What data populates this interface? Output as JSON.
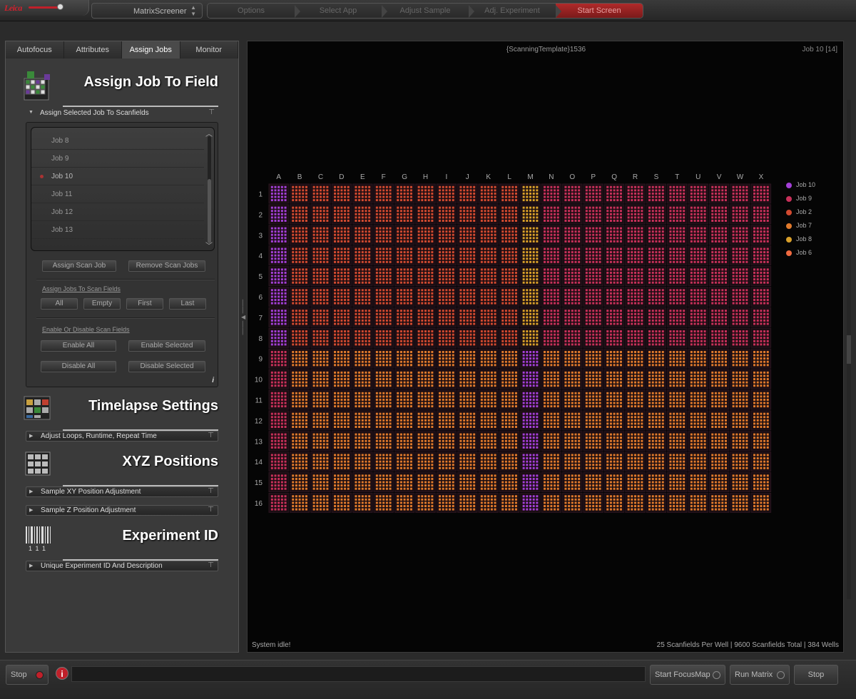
{
  "app": {
    "logo_text": "Leica",
    "selector_label": "MatrixScreener"
  },
  "workflow": {
    "steps": [
      "Options",
      "Select App",
      "Adjust Sample",
      "Adj. Experiment",
      "Start Screen"
    ]
  },
  "tabs": [
    "Autofocus",
    "Attributes",
    "Assign Jobs",
    "Monitor"
  ],
  "assign": {
    "title": "Assign Job To Field",
    "bar_label": "Assign Selected Job To Scanfields",
    "jobs": [
      "Job 8",
      "Job 9",
      "Job 10",
      "Job 11",
      "Job 12",
      "Job 13"
    ],
    "selected_job": "Job 10",
    "assign_btn": "Assign Scan Job",
    "remove_btn": "Remove Scan Jobs",
    "assign_fields_label": "Assign Jobs To Scan Fields",
    "field_btns": [
      "All",
      "Empty",
      "First",
      "Last"
    ],
    "enable_label": "Enable Or Disable Scan Fields",
    "enable_all": "Enable All",
    "enable_sel": "Enable Selected",
    "disable_all": "Disable All",
    "disable_sel": "Disable Selected",
    "info_glyph": "i"
  },
  "timelapse": {
    "title": "Timelapse Settings",
    "bar_label": "Adjust Loops, Runtime, Repeat Time"
  },
  "xyz": {
    "title": "XYZ Positions",
    "bar_xy": "Sample XY Position Adjustment",
    "bar_z": "Sample Z Position Adjustment"
  },
  "experiment": {
    "title": "Experiment ID",
    "bar_label": "Unique Experiment ID And Description",
    "barcode_digits": "1 1 1"
  },
  "view": {
    "title": "{ScanningTemplate}1536",
    "job_indicator": "Job 10 [14]",
    "status": "System idle!",
    "stats": "25  Scanfields Per Well | 9600  Scanfields Total | 384  Wells"
  },
  "plate": {
    "columns": [
      "A",
      "B",
      "C",
      "D",
      "E",
      "F",
      "G",
      "H",
      "I",
      "J",
      "K",
      "L",
      "M",
      "N",
      "O",
      "P",
      "Q",
      "R",
      "S",
      "T",
      "U",
      "V",
      "W",
      "X"
    ],
    "rows": [
      "1",
      "2",
      "3",
      "4",
      "5",
      "6",
      "7",
      "8",
      "9",
      "10",
      "11",
      "12",
      "13",
      "14",
      "15",
      "16"
    ],
    "fields_per_side": 5
  },
  "legend": [
    {
      "name": "Job 10",
      "color": "#a33fd6"
    },
    {
      "name": "Job 9",
      "color": "#c8305a"
    },
    {
      "name": "Job 2",
      "color": "#d24a30"
    },
    {
      "name": "Job 7",
      "color": "#e07a2c"
    },
    {
      "name": "Job 8",
      "color": "#d9a02a"
    },
    {
      "name": "Job 6",
      "color": "#f06a40"
    }
  ],
  "bottom": {
    "stop_left": "Stop",
    "info_glyph": "i",
    "start_focus": "Start FocusMap",
    "run_matrix": "Run Matrix",
    "stop_right": "Stop"
  }
}
